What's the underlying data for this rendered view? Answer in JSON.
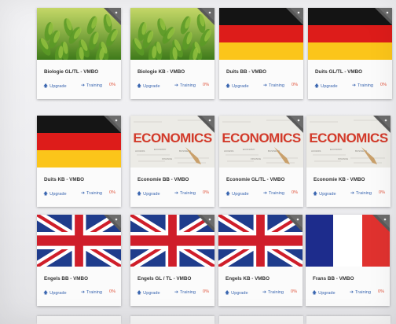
{
  "cards": [
    {
      "title": "Biologie GL/TL - VMBO",
      "thumb": "green-leaves",
      "upgrade": "Upgrade",
      "training": "Training",
      "percent": "0%"
    },
    {
      "title": "Biologie KB - VMBO",
      "thumb": "green-leaves",
      "upgrade": "Upgrade",
      "training": "Training",
      "percent": "0%"
    },
    {
      "title": "Duits BB - VMBO",
      "thumb": "german-flag",
      "upgrade": "Upgrade",
      "training": "Training",
      "percent": "0%"
    },
    {
      "title": "Duits GL/TL - VMBO",
      "thumb": "german-flag",
      "upgrade": "Upgrade",
      "training": "Training",
      "percent": "0%"
    },
    {
      "title": "Duits KB - VMBO",
      "thumb": "german-flag",
      "upgrade": "Upgrade",
      "training": "Training",
      "percent": "0%"
    },
    {
      "title": "Economie BB - VMBO",
      "thumb": "economics",
      "upgrade": "Upgrade",
      "training": "Training",
      "percent": "0%"
    },
    {
      "title": "Economie GL/TL - VMBO",
      "thumb": "economics",
      "upgrade": "Upgrade",
      "training": "Training",
      "percent": "0%"
    },
    {
      "title": "Economie KB - VMBO",
      "thumb": "economics",
      "upgrade": "Upgrade",
      "training": "Training",
      "percent": "0%"
    },
    {
      "title": "Engels BB - VMBO",
      "thumb": "uk-flag",
      "upgrade": "Upgrade",
      "training": "Training",
      "percent": "0%"
    },
    {
      "title": "Engels GL / TL - VMBO",
      "thumb": "uk-flag",
      "upgrade": "Upgrade",
      "training": "Training",
      "percent": "0%"
    },
    {
      "title": "Engels KB - VMBO",
      "thumb": "uk-flag",
      "upgrade": "Upgrade",
      "training": "Training",
      "percent": "0%"
    },
    {
      "title": "Frans BB - VMBO",
      "thumb": "french-flag",
      "upgrade": "Upgrade",
      "training": "Training",
      "percent": "0%"
    }
  ],
  "economics_word": "ECONOMICS",
  "colors": {
    "link": "#3a66b0",
    "percent": "#e0533b",
    "corner_ribbon": "#5a5a5a"
  }
}
